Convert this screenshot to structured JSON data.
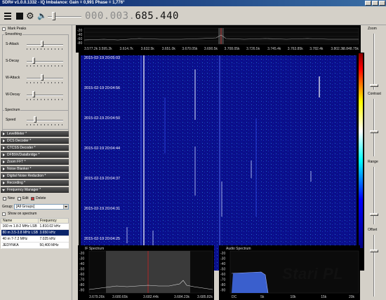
{
  "window": {
    "title": "SDR# v1.0.0.1332 - IQ Imbalance: Gain = 0,991 Phase = 1,776°"
  },
  "toolbar": {
    "frequency_dim": "000.003.",
    "frequency_lit": "685.440"
  },
  "left": {
    "mark_peaks": "Mark Peaks",
    "smoothing": {
      "title": "Smoothing",
      "sliders": [
        "S-Attack",
        "S-Decay",
        "W-Attack",
        "W-Decay"
      ]
    },
    "spectrum": {
      "title": "Spectrum",
      "speed": "Speed"
    },
    "plugins": [
      "LevelMeter *",
      "DCS Decoder *",
      "CTCSS Decoder *",
      "DFB9X/Datalbridge *",
      "Zoom FFT *",
      "Noise Blanker *",
      "Digital Noise Reduction *",
      "Recording *",
      "Frequency Manager *"
    ],
    "freq_manager": {
      "new": "New",
      "edit": "Edit",
      "delete": "Delete",
      "group_label": "Group:",
      "group_value": "[All Groups]",
      "show_on_spectrum": "Show on spectrum",
      "columns": [
        "Name",
        "Frequency"
      ],
      "rows": [
        [
          "160 m 1.8-2 MHz LSB",
          "1.810.02 kHz"
        ],
        [
          "80 m 3.5-3.8 MHz LSB",
          "3.650 kHz"
        ],
        [
          "40 m 7-7.2 MHz",
          "7.025 kHz"
        ],
        [
          "JEDYNKA",
          "50,400 MHz"
        ]
      ]
    }
  },
  "top_spectrum": {
    "db_labels": [
      "-20",
      "-40",
      "-60",
      "-80"
    ],
    "freq_labels": [
      "3.577.2k",
      "3.595.2k",
      "3.614.7k",
      "3.632.5k",
      "3.651.0k",
      "3.670.05k",
      "3.690.5k",
      "3.708.05k",
      "3.726.5k",
      "3.745.4k",
      "3.763.85k",
      "3.782.4k",
      "3.802.3k",
      "3.848.75k"
    ]
  },
  "waterfall": {
    "timestamps": [
      "2015-02-19 20:05:03",
      "2015-02-19 20:04:56",
      "2015-02-19 20:04:50",
      "2015-02-19 20:04:44",
      "2015-02-19 20:04:37",
      "2015-02-19 20:04:31",
      "2015-02-19 20:04:25"
    ]
  },
  "right": {
    "zoom": "Zoom",
    "contrast": "Contrast",
    "range": "Range",
    "offset": "Offset"
  },
  "if_spectrum": {
    "title": "IF Spectrum",
    "db_labels": [
      "-20",
      "-30",
      "-40",
      "-50",
      "-60",
      "-70",
      "-80",
      "-90"
    ],
    "freq_labels": [
      "3.679.26k",
      "3.680.65k",
      "3.682.44k",
      "3.684.23k",
      "3.685.82k"
    ]
  },
  "audio_spectrum": {
    "title": "Audio Spectrum",
    "db_labels": [
      "-20",
      "-30",
      "-40",
      "-50",
      "-60",
      "-70",
      "-80",
      "-90"
    ],
    "freq_labels": [
      "DC",
      "5k",
      "10k",
      "15k",
      "20k"
    ]
  },
  "watermark": "Stari PL",
  "colors": {
    "waterfall_bg": "#0a0f8a",
    "spectrum_fill": "#3a5fcd",
    "selection": "#0a246a"
  }
}
